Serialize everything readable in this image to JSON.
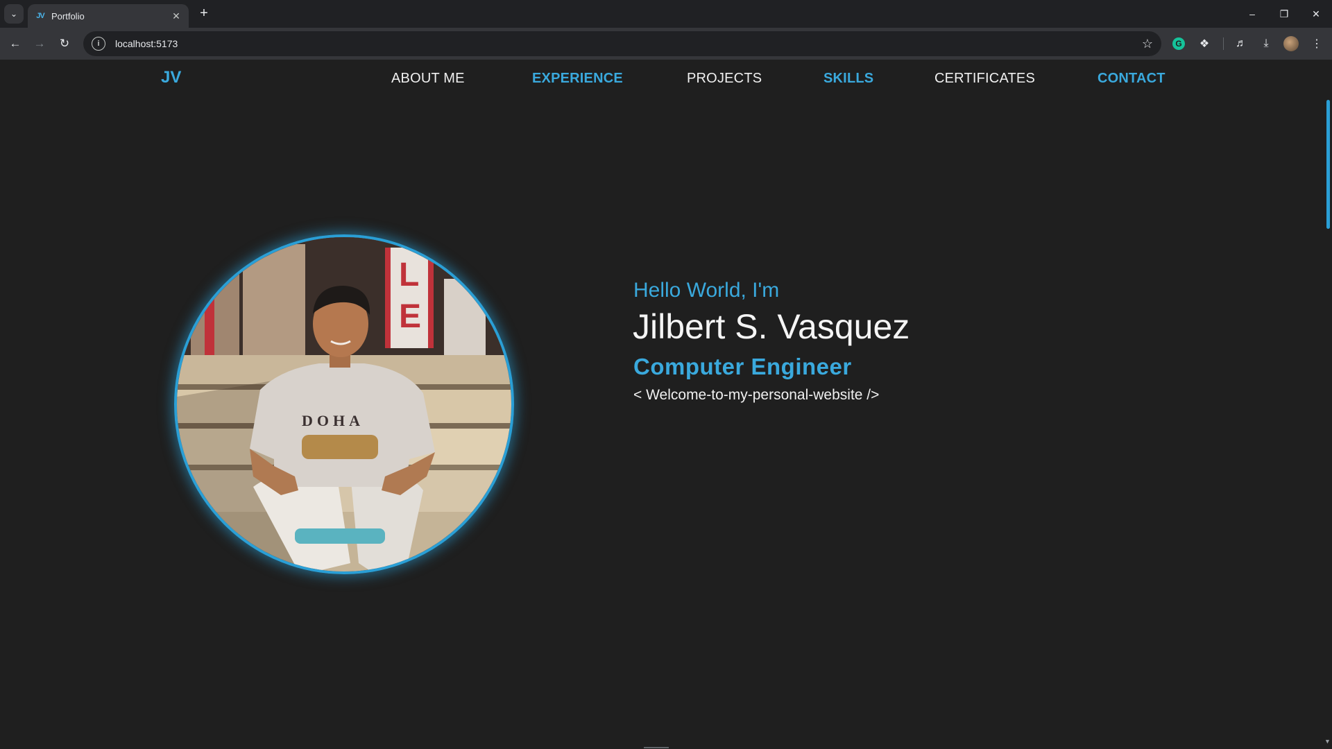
{
  "browser": {
    "tab_title": "Portfolio",
    "tab_favicon": "JV",
    "url": "localhost:5173",
    "icons": {
      "tab_list": "chevron-down-icon",
      "close_tab": "close-icon",
      "new_tab": "plus-icon",
      "minimize": "minimize-icon",
      "restore": "restore-icon",
      "close_window": "close-icon",
      "back": "arrow-left-icon",
      "forward": "arrow-right-icon",
      "reload": "reload-icon",
      "site_info": "info-icon",
      "bookmark": "star-icon",
      "grammarly": "grammarly-icon",
      "extensions": "puzzle-icon",
      "media": "queue-music-icon",
      "downloads": "download-icon",
      "profile": "avatar-icon",
      "menu": "more-vert-icon"
    }
  },
  "site": {
    "logo": "JV",
    "nav": [
      {
        "label": "ABOUT ME",
        "accent": false
      },
      {
        "label": "EXPERIENCE",
        "accent": true
      },
      {
        "label": "PROJECTS",
        "accent": false
      },
      {
        "label": "SKILLS",
        "accent": true
      },
      {
        "label": "CERTIFICATES",
        "accent": false
      },
      {
        "label": "CONTACT",
        "accent": true
      }
    ],
    "accent_color": "#3aa9dd",
    "background_color": "#1f1f1f"
  },
  "hero": {
    "greeting": "Hello World, I'm",
    "name": "Jilbert S. Vasquez",
    "role": "Computer Engineer",
    "tagline": "< Welcome-to-my-personal-website />"
  }
}
